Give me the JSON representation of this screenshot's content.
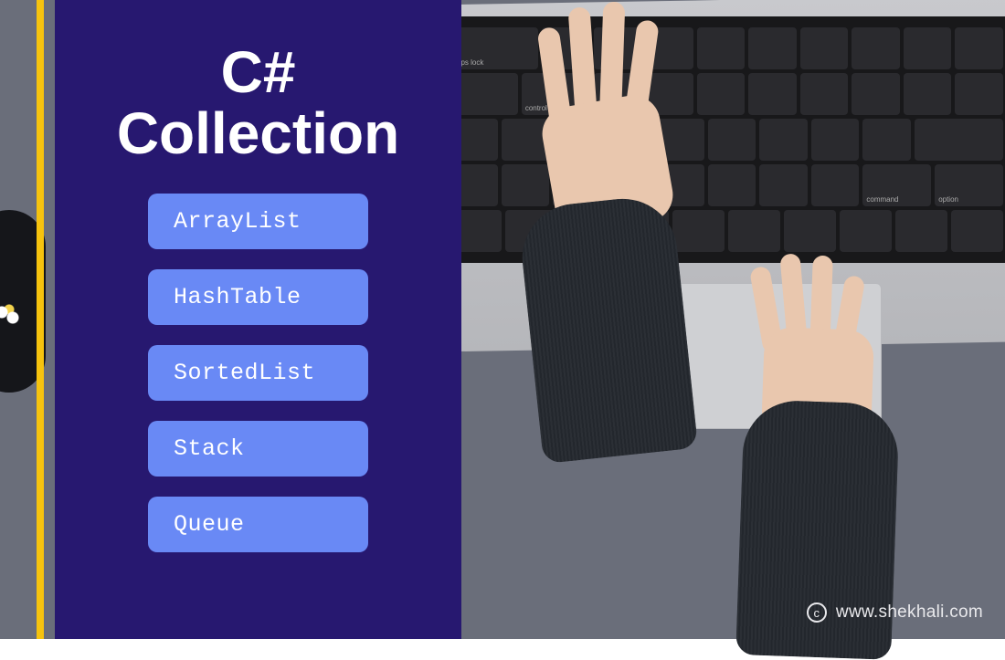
{
  "title_line1": "C#",
  "title_line2": "Collection",
  "items": [
    "ArrayList",
    "HashTable",
    "SortedList",
    "Stack",
    "Queue"
  ],
  "attribution": "www.shekhali.com",
  "colors": {
    "panel": "#271870",
    "accent_stripe": "#f6c30e",
    "item_bg": "#6989f5"
  }
}
